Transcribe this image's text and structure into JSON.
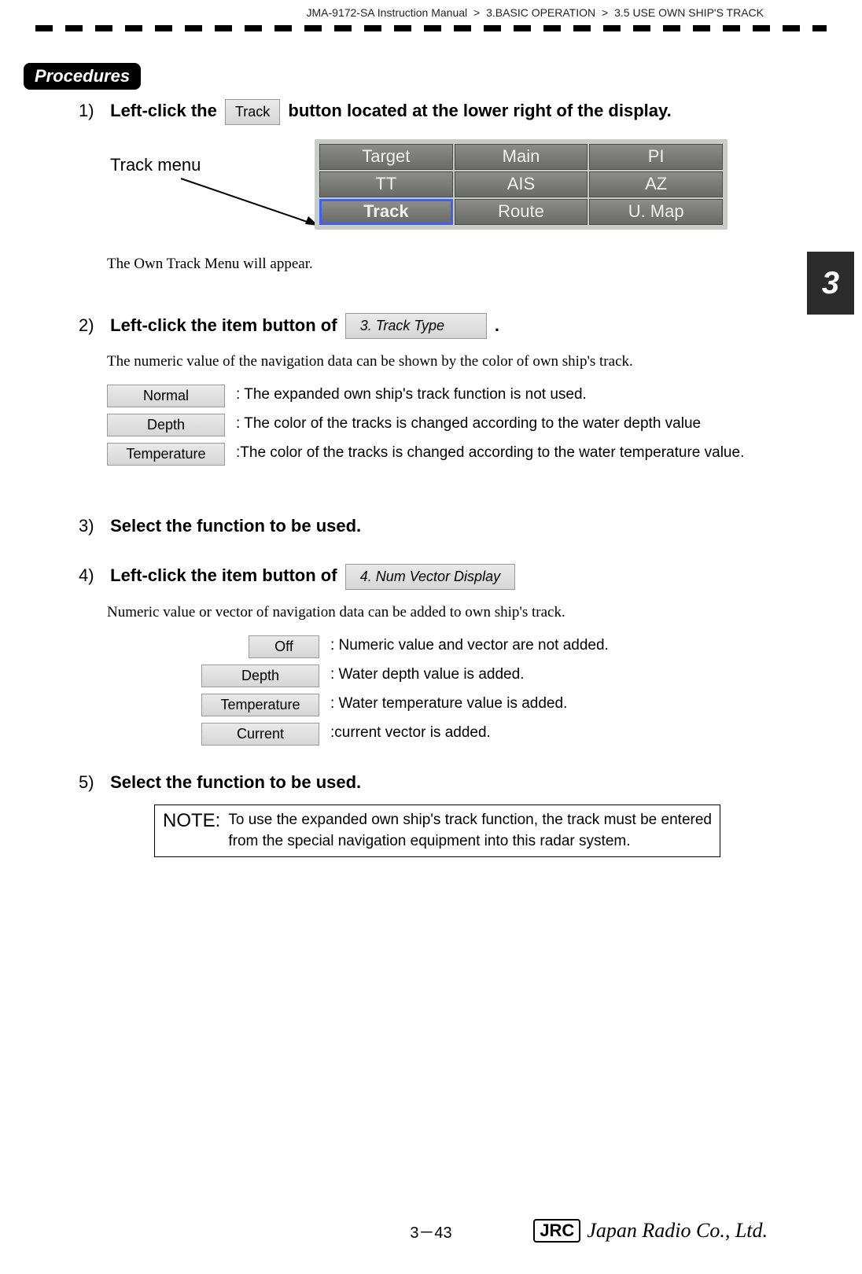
{
  "header": {
    "manual": "JMA-9172-SA Instruction Manual",
    "chapter": "3.BASIC OPERATION",
    "section": "3.5  USE OWN SHIP'S TRACK",
    "sep": ">"
  },
  "procedures_label": "Procedures",
  "chapter_tab": "3",
  "step1": {
    "num": "1)",
    "text_a": "Left-click the",
    "btn": "Track",
    "text_b": " button located at the lower right of the display."
  },
  "track_menu": {
    "label": "Track menu",
    "cells": [
      "Target",
      "Main",
      "PI",
      "TT",
      "AIS",
      "AZ",
      "Track",
      "Route",
      "U. Map"
    ]
  },
  "step1_result": "The Own Track Menu will appear.",
  "step2": {
    "num": "2)",
    "text_a": " Left-click the item button of ",
    "btn": "3. Track Type",
    "text_b": "."
  },
  "step2_result": "The numeric value of the navigation data can be shown by the color of own ship's track.",
  "track_type_options": [
    {
      "label": "Normal",
      "desc": ": The expanded own ship's track function is not used."
    },
    {
      "label": "Depth",
      "desc": ": The color of the tracks is changed according to the water depth value"
    },
    {
      "label": "Temperature",
      "desc": ":The color of the tracks is changed according to the water temperature value."
    }
  ],
  "step3": {
    "num": "3)",
    "text": "Select the function to be used."
  },
  "step4": {
    "num": "4)",
    "text_a": "Left-click the item button of ",
    "btn": "4. Num Vector Display"
  },
  "step4_result": "Numeric value or vector of navigation data can be added to own ship's track.",
  "vector_options": [
    {
      "label": "Off",
      "desc": ": Numeric value and vector are not added.",
      "narrow": true
    },
    {
      "label": "Depth",
      "desc": ": Water depth value is added."
    },
    {
      "label": "Temperature",
      "desc": ": Water temperature value is added."
    },
    {
      "label": "Current",
      "desc": ":current vector is added."
    }
  ],
  "step5": {
    "num": "5)",
    "text": "Select the function to be used."
  },
  "note": {
    "label": "NOTE:",
    "text": "To use the expanded own ship's track function, the track must be entered from the special navigation equipment into this radar system."
  },
  "footer": {
    "page": "3－43",
    "logo_badge": "JRC",
    "logo_text": "Japan Radio Co., Ltd."
  }
}
